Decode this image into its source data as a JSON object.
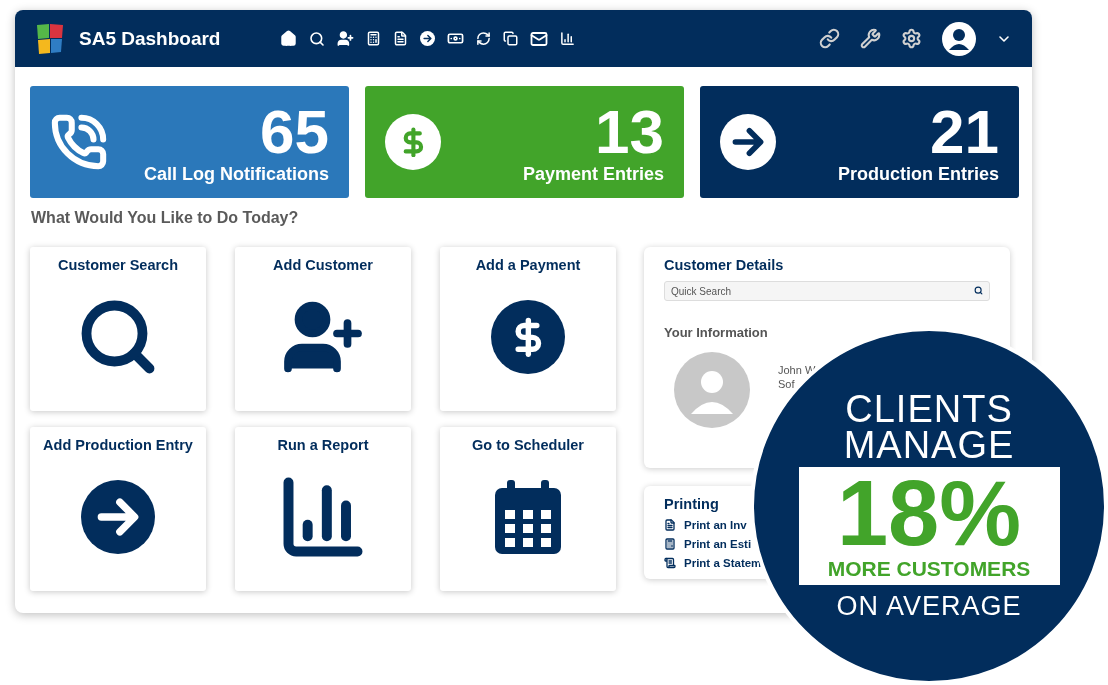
{
  "app": {
    "title": "SA5 Dashboard"
  },
  "stats": [
    {
      "value": "65",
      "label": "Call Log Notifications",
      "color": "#2b78ba",
      "kind": "phone"
    },
    {
      "value": "13",
      "label": "Payment Entries",
      "color": "#42a42a",
      "kind": "dollar"
    },
    {
      "value": "21",
      "label": "Production Entries",
      "color": "#022d5c",
      "kind": "arrow"
    }
  ],
  "prompt": "What Would You Like to Do Today?",
  "tiles": [
    {
      "title": "Customer Search",
      "kind": "search"
    },
    {
      "title": "Add Customer",
      "kind": "user-plus"
    },
    {
      "title": "Add a Payment",
      "kind": "dollar"
    },
    {
      "title": "Add Production Entry",
      "kind": "arrow"
    },
    {
      "title": "Run a Report",
      "kind": "chart"
    },
    {
      "title": "Go to Scheduler",
      "kind": "calendar"
    }
  ],
  "customer_details": {
    "title": "Customer Details",
    "search": {
      "placeholder": "Quick Search"
    },
    "section": "Your Information",
    "name": "John W",
    "role": "Sof"
  },
  "printing": {
    "title": "Printing",
    "items": [
      {
        "label": "Print an Inv",
        "kind": "document"
      },
      {
        "label": "Print an Esti",
        "kind": "calculator"
      },
      {
        "label": "Print a Statem",
        "kind": "statement"
      }
    ]
  },
  "badge": {
    "top": [
      "CLIENTS",
      "MANAGE"
    ],
    "figure": "18%",
    "figure_caption": "MORE CUSTOMERS",
    "bottom": "ON AVERAGE"
  }
}
